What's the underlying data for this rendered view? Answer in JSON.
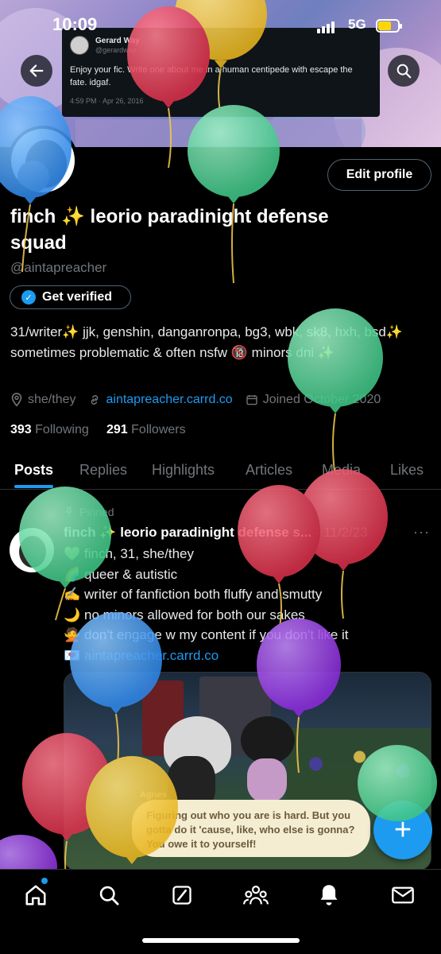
{
  "status_bar": {
    "time": "10:09",
    "network": "5G"
  },
  "banner_tweet": {
    "name": "Gerard Way",
    "handle": "@gerardway",
    "text": "Enjoy your fic. Write one about me in a human centipede with escape the fate. idgaf.",
    "timestamp": "4:59 PM · Apr 26, 2016"
  },
  "profile": {
    "edit_label": "Edit profile",
    "name": "finch ✨ leorio paradinight defense squad",
    "handle": "@aintapreacher",
    "verify_label": "Get verified",
    "bio": "31/writer✨ jjk, genshin, danganronpa, bg3, wbk, sk8, hxh, bsd✨ sometimes problematic & often nsfw 🔞 minors dni ✨",
    "pronouns": "she/they",
    "website": "aintapreacher.carrd.co",
    "joined": "Joined October 2020",
    "following_count": "393",
    "following_label": "Following",
    "followers_count": "291",
    "followers_label": "Followers"
  },
  "tabs": [
    "Posts",
    "Replies",
    "Highlights",
    "Articles",
    "Media",
    "Likes"
  ],
  "post": {
    "pinned_label": "Pinned",
    "author": "finch ✨ leorio paradinight defense s...",
    "date": "· 11/2/23",
    "more": "···",
    "lines": [
      {
        "icon": "💚",
        "text": "finch, 31, she/they"
      },
      {
        "icon": "🌈",
        "text": "queer & autistic"
      },
      {
        "icon": "✍️",
        "text": "writer of fanfiction both fluffy and smutty"
      },
      {
        "icon": "🌙",
        "text": "no minors allowed for both our sakes"
      },
      {
        "icon": "🙅",
        "text": "don't engage w my content if you don't like it"
      },
      {
        "icon": "💌",
        "text": "aintapreacher.carrd.co"
      }
    ],
    "media_speaker": "Agnes",
    "media_caption": "Figuring out who you are is hard. But you gotta do it 'cause, like, who else is gonna? You owe it to yourself!"
  },
  "fab_label": "+",
  "icons": {
    "back": "arrow-left-icon",
    "search": "search-icon",
    "home": "home-icon",
    "explore": "search-icon",
    "grok": "grok-icon",
    "communities": "people-icon",
    "notifications": "bell-icon",
    "messages": "mail-icon"
  },
  "colors": {
    "accent": "#1d9bf0",
    "background": "#000000",
    "muted": "#71767b"
  }
}
